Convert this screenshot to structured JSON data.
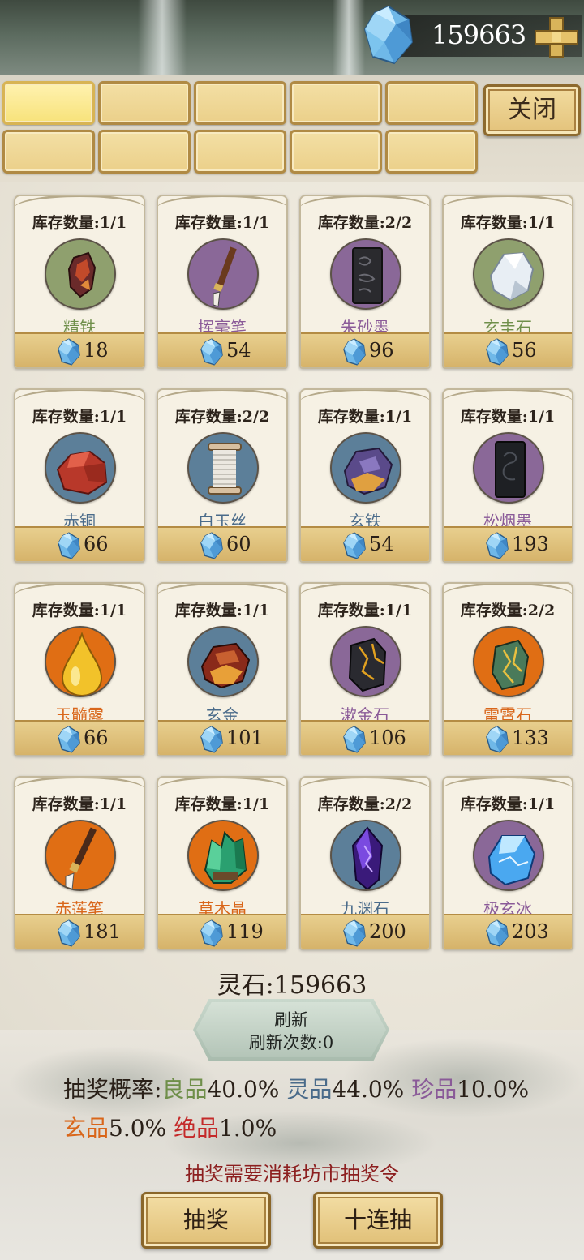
{
  "header": {
    "currency_value": "159663",
    "currency_icon": "spirit-stone-gem-icon",
    "add_icon": "plus-icon"
  },
  "tabs": {
    "close_label": "关闭",
    "count": 10,
    "active_index": 0
  },
  "colors": {
    "green": "#6f8f4a",
    "blue": "#4a6b8a",
    "purple": "#8a5a98",
    "orange": "#d9661a",
    "red": "#c42a2a",
    "circle_green": "#8fa06e",
    "circle_purple": "#8a6898",
    "circle_blue": "#5c7f99",
    "circle_orange": "#e06e14"
  },
  "items": [
    {
      "stock": "库存数量:1/1",
      "name": "精铁",
      "price": "18",
      "grade": "green",
      "icon": "refined-iron-ore-icon"
    },
    {
      "stock": "库存数量:1/1",
      "name": "挥毫笔",
      "price": "54",
      "grade": "purple",
      "icon": "brush-icon"
    },
    {
      "stock": "库存数量:2/2",
      "name": "朱砂墨",
      "price": "96",
      "grade": "purple",
      "icon": "ink-stick-icon"
    },
    {
      "stock": "库存数量:1/1",
      "name": "玄圭石",
      "price": "56",
      "grade": "green",
      "icon": "white-stone-icon"
    },
    {
      "stock": "库存数量:1/1",
      "name": "赤铜",
      "price": "66",
      "grade": "blue",
      "icon": "red-copper-icon"
    },
    {
      "stock": "库存数量:2/2",
      "name": "白玉丝",
      "price": "60",
      "grade": "blue",
      "icon": "thread-spool-icon"
    },
    {
      "stock": "库存数量:1/1",
      "name": "玄铁",
      "price": "54",
      "grade": "blue",
      "icon": "dark-iron-icon"
    },
    {
      "stock": "库存数量:1/1",
      "name": "松烟墨",
      "price": "193",
      "grade": "purple",
      "icon": "pine-ink-icon"
    },
    {
      "stock": "库存数量:1/1",
      "name": "玉髓露",
      "price": "66",
      "grade": "orange",
      "icon": "golden-drop-icon"
    },
    {
      "stock": "库存数量:1/1",
      "name": "玄金",
      "price": "101",
      "grade": "blue",
      "icon": "dark-gold-icon"
    },
    {
      "stock": "库存数量:1/1",
      "name": "漱金石",
      "price": "106",
      "grade": "purple",
      "icon": "gold-vein-stone-icon"
    },
    {
      "stock": "库存数量:2/2",
      "name": "雷霄石",
      "price": "133",
      "grade": "orange",
      "icon": "thunder-stone-icon"
    },
    {
      "stock": "库存数量:1/1",
      "name": "赤莲笔",
      "price": "181",
      "grade": "orange",
      "icon": "red-lotus-brush-icon"
    },
    {
      "stock": "库存数量:1/1",
      "name": "草木晶",
      "price": "119",
      "grade": "orange",
      "icon": "green-crystal-icon"
    },
    {
      "stock": "库存数量:2/2",
      "name": "九渊石",
      "price": "200",
      "grade": "blue",
      "icon": "abyss-crystal-icon"
    },
    {
      "stock": "库存数量:1/1",
      "name": "极玄冰",
      "price": "203",
      "grade": "purple",
      "icon": "ice-crystal-icon"
    }
  ],
  "footer": {
    "spirit_stone_label": "灵石:159663",
    "refresh_label": "刷新",
    "refresh_count_label": "刷新次数:0",
    "prob_prefix": "抽奖概率:",
    "prob_good_name": "良品",
    "prob_good_value": "40.0%",
    "prob_spirit_name": "灵品",
    "prob_spirit_value": "44.0%",
    "prob_rare_name": "珍品",
    "prob_rare_value": "10.0%",
    "prob_mystic_name": "玄品",
    "prob_mystic_value": "5.0%",
    "prob_peerless_name": "绝品",
    "prob_peerless_value": "1.0%",
    "notice": "抽奖需要消耗坊市抽奖令",
    "draw_label": "抽奖",
    "draw_ten_label": "十连抽"
  }
}
